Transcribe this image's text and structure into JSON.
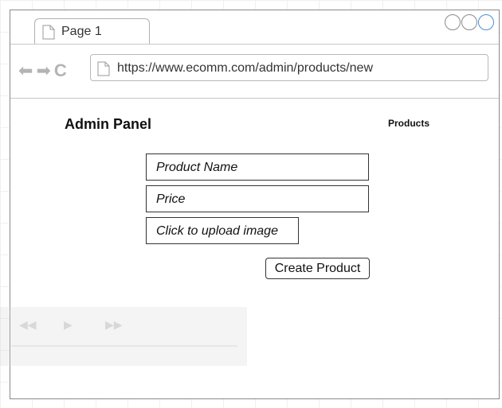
{
  "browser": {
    "tab_label": "Page 1",
    "url": "https://www.ecomm.com/admin/products/new"
  },
  "header": {
    "app_title": "Admin Panel",
    "nav_link": "Products"
  },
  "form": {
    "product_name_placeholder": "Product Name",
    "price_placeholder": "Price",
    "upload_label": "Click to upload image",
    "submit_label": "Create Product"
  },
  "icons": {
    "back": "back-arrow-icon",
    "forward": "forward-arrow-icon",
    "reload": "reload-icon",
    "page": "page-icon"
  },
  "colors": {
    "active_control": "#4a90d9",
    "disabled_nav": "#b4b4b4"
  }
}
